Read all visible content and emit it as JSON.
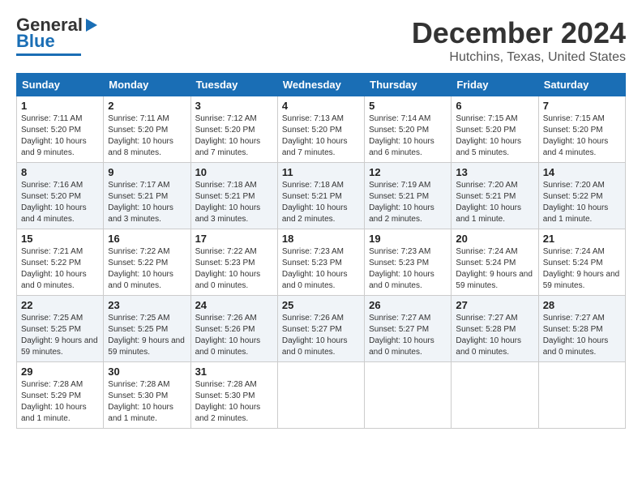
{
  "header": {
    "logo_line1": "General",
    "logo_line2": "Blue",
    "month": "December 2024",
    "location": "Hutchins, Texas, United States"
  },
  "weekdays": [
    "Sunday",
    "Monday",
    "Tuesday",
    "Wednesday",
    "Thursday",
    "Friday",
    "Saturday"
  ],
  "weeks": [
    [
      {
        "day": "1",
        "sunrise": "7:11 AM",
        "sunset": "5:20 PM",
        "daylight": "10 hours and 9 minutes."
      },
      {
        "day": "2",
        "sunrise": "7:11 AM",
        "sunset": "5:20 PM",
        "daylight": "10 hours and 8 minutes."
      },
      {
        "day": "3",
        "sunrise": "7:12 AM",
        "sunset": "5:20 PM",
        "daylight": "10 hours and 7 minutes."
      },
      {
        "day": "4",
        "sunrise": "7:13 AM",
        "sunset": "5:20 PM",
        "daylight": "10 hours and 7 minutes."
      },
      {
        "day": "5",
        "sunrise": "7:14 AM",
        "sunset": "5:20 PM",
        "daylight": "10 hours and 6 minutes."
      },
      {
        "day": "6",
        "sunrise": "7:15 AM",
        "sunset": "5:20 PM",
        "daylight": "10 hours and 5 minutes."
      },
      {
        "day": "7",
        "sunrise": "7:15 AM",
        "sunset": "5:20 PM",
        "daylight": "10 hours and 4 minutes."
      }
    ],
    [
      {
        "day": "8",
        "sunrise": "7:16 AM",
        "sunset": "5:20 PM",
        "daylight": "10 hours and 4 minutes."
      },
      {
        "day": "9",
        "sunrise": "7:17 AM",
        "sunset": "5:21 PM",
        "daylight": "10 hours and 3 minutes."
      },
      {
        "day": "10",
        "sunrise": "7:18 AM",
        "sunset": "5:21 PM",
        "daylight": "10 hours and 3 minutes."
      },
      {
        "day": "11",
        "sunrise": "7:18 AM",
        "sunset": "5:21 PM",
        "daylight": "10 hours and 2 minutes."
      },
      {
        "day": "12",
        "sunrise": "7:19 AM",
        "sunset": "5:21 PM",
        "daylight": "10 hours and 2 minutes."
      },
      {
        "day": "13",
        "sunrise": "7:20 AM",
        "sunset": "5:21 PM",
        "daylight": "10 hours and 1 minute."
      },
      {
        "day": "14",
        "sunrise": "7:20 AM",
        "sunset": "5:22 PM",
        "daylight": "10 hours and 1 minute."
      }
    ],
    [
      {
        "day": "15",
        "sunrise": "7:21 AM",
        "sunset": "5:22 PM",
        "daylight": "10 hours and 0 minutes."
      },
      {
        "day": "16",
        "sunrise": "7:22 AM",
        "sunset": "5:22 PM",
        "daylight": "10 hours and 0 minutes."
      },
      {
        "day": "17",
        "sunrise": "7:22 AM",
        "sunset": "5:23 PM",
        "daylight": "10 hours and 0 minutes."
      },
      {
        "day": "18",
        "sunrise": "7:23 AM",
        "sunset": "5:23 PM",
        "daylight": "10 hours and 0 minutes."
      },
      {
        "day": "19",
        "sunrise": "7:23 AM",
        "sunset": "5:23 PM",
        "daylight": "10 hours and 0 minutes."
      },
      {
        "day": "20",
        "sunrise": "7:24 AM",
        "sunset": "5:24 PM",
        "daylight": "9 hours and 59 minutes."
      },
      {
        "day": "21",
        "sunrise": "7:24 AM",
        "sunset": "5:24 PM",
        "daylight": "9 hours and 59 minutes."
      }
    ],
    [
      {
        "day": "22",
        "sunrise": "7:25 AM",
        "sunset": "5:25 PM",
        "daylight": "9 hours and 59 minutes."
      },
      {
        "day": "23",
        "sunrise": "7:25 AM",
        "sunset": "5:25 PM",
        "daylight": "9 hours and 59 minutes."
      },
      {
        "day": "24",
        "sunrise": "7:26 AM",
        "sunset": "5:26 PM",
        "daylight": "10 hours and 0 minutes."
      },
      {
        "day": "25",
        "sunrise": "7:26 AM",
        "sunset": "5:27 PM",
        "daylight": "10 hours and 0 minutes."
      },
      {
        "day": "26",
        "sunrise": "7:27 AM",
        "sunset": "5:27 PM",
        "daylight": "10 hours and 0 minutes."
      },
      {
        "day": "27",
        "sunrise": "7:27 AM",
        "sunset": "5:28 PM",
        "daylight": "10 hours and 0 minutes."
      },
      {
        "day": "28",
        "sunrise": "7:27 AM",
        "sunset": "5:28 PM",
        "daylight": "10 hours and 0 minutes."
      }
    ],
    [
      {
        "day": "29",
        "sunrise": "7:28 AM",
        "sunset": "5:29 PM",
        "daylight": "10 hours and 1 minute."
      },
      {
        "day": "30",
        "sunrise": "7:28 AM",
        "sunset": "5:30 PM",
        "daylight": "10 hours and 1 minute."
      },
      {
        "day": "31",
        "sunrise": "7:28 AM",
        "sunset": "5:30 PM",
        "daylight": "10 hours and 2 minutes."
      },
      null,
      null,
      null,
      null
    ]
  ]
}
